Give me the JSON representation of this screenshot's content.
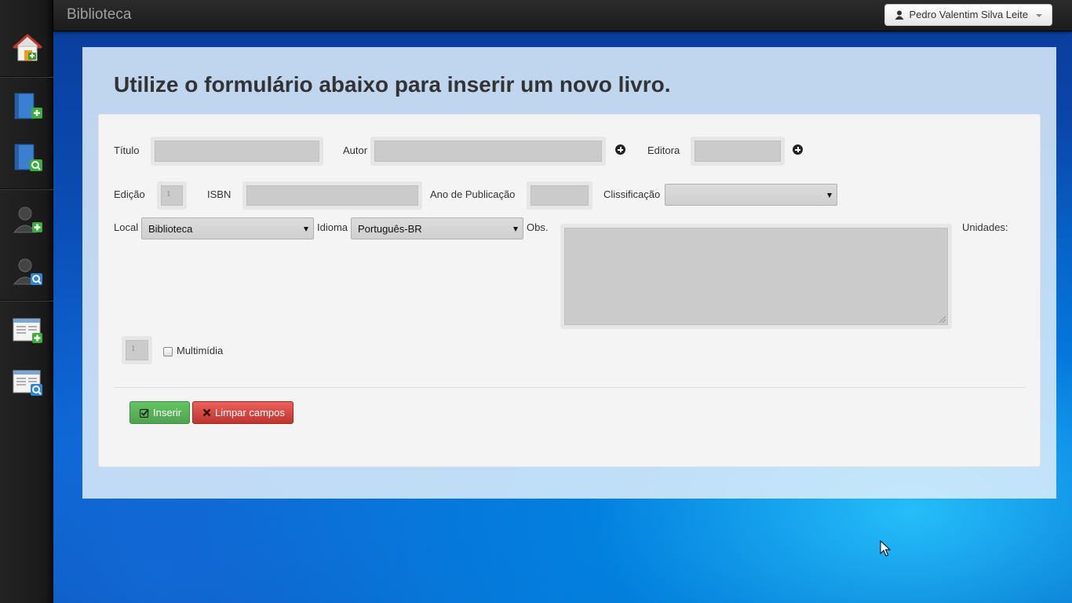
{
  "app": {
    "title": "Biblioteca"
  },
  "user_menu": {
    "name": "Pedro Valentim Silva Leite"
  },
  "sidebar": {
    "items": [
      {
        "name": "home-icon"
      },
      {
        "name": "add-book-icon"
      },
      {
        "name": "search-book-icon"
      },
      {
        "name": "add-user-icon"
      },
      {
        "name": "search-user-icon"
      },
      {
        "name": "add-loan-icon"
      },
      {
        "name": "search-loan-icon"
      }
    ]
  },
  "page": {
    "heading": "Utilize o formulário abaixo para inserir um novo livro."
  },
  "form": {
    "titulo_label": "Título",
    "autor_label": "Autor",
    "editora_label": "Editora",
    "edicao_label": "Edição",
    "edicao_placeholder": "1",
    "isbn_label": "ISBN",
    "ano_label": "Ano de Publicação",
    "classificacao_label": "Clissificação",
    "classificacao_value": "",
    "local_label": "Local",
    "local_value": "Biblioteca",
    "idioma_label": "Idioma",
    "idioma_value": "Português-BR",
    "obs_label": "Obs.",
    "unidades_label": "Unidades:",
    "unidades_placeholder": "1",
    "multimidia_label": "Multimídia",
    "multimidia_checked": false
  },
  "actions": {
    "insert_label": "Inserir",
    "clear_label": "Limpar campos"
  },
  "colors": {
    "topbar": "#1b1b1b",
    "sidebar": "#1a1a1a",
    "insert_button": "#51a351",
    "clear_button": "#bd362f"
  }
}
